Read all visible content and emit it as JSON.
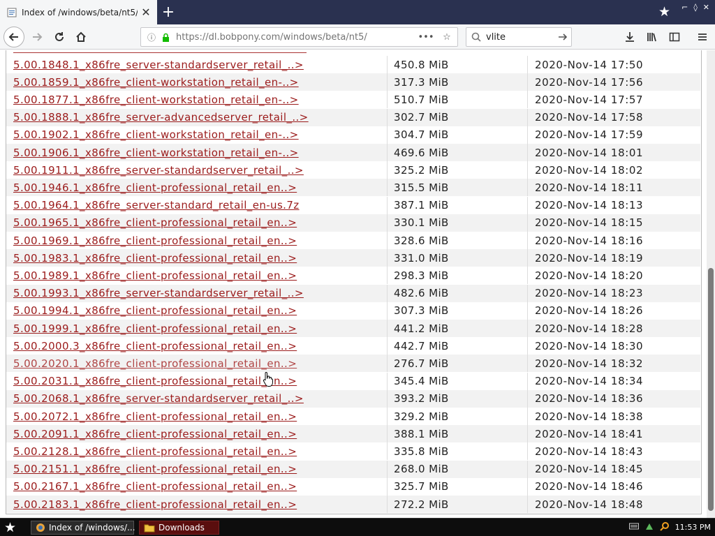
{
  "browser": {
    "tab": {
      "title": "Index of /windows/beta/nt5/",
      "close": "✕"
    },
    "new_tab": "+",
    "window_controls": [
      "⌐",
      "◊",
      "✕"
    ],
    "url": "https://dl.bobpony.com/windows/beta/nt5/",
    "search_value": "vlite"
  },
  "files": [
    {
      "name": "5.00.1848.1_x86fre_server-standardserver_retail_..>",
      "size": "450.8 MiB",
      "date": "2020-Nov-14 17:50"
    },
    {
      "name": "5.00.1859.1_x86fre_client-workstation_retail_en-..>",
      "size": "317.3 MiB",
      "date": "2020-Nov-14 17:56"
    },
    {
      "name": "5.00.1877.1_x86fre_client-workstation_retail_en-..>",
      "size": "510.7 MiB",
      "date": "2020-Nov-14 17:57"
    },
    {
      "name": "5.00.1888.1_x86fre_server-advancedserver_retail_..>",
      "size": "302.7 MiB",
      "date": "2020-Nov-14 17:58"
    },
    {
      "name": "5.00.1902.1_x86fre_client-workstation_retail_en-..>",
      "size": "304.7 MiB",
      "date": "2020-Nov-14 17:59"
    },
    {
      "name": "5.00.1906.1_x86fre_client-workstation_retail_en-..>",
      "size": "469.6 MiB",
      "date": "2020-Nov-14 18:01"
    },
    {
      "name": "5.00.1911.1_x86fre_server-standardserver_retail_..>",
      "size": "325.2 MiB",
      "date": "2020-Nov-14 18:02"
    },
    {
      "name": "5.00.1946.1_x86fre_client-professional_retail_en..>",
      "size": "315.5 MiB",
      "date": "2020-Nov-14 18:11"
    },
    {
      "name": "5.00.1964.1_x86fre_server-standard_retail_en-us.7z",
      "size": "387.1 MiB",
      "date": "2020-Nov-14 18:13"
    },
    {
      "name": "5.00.1965.1_x86fre_client-professional_retail_en..>",
      "size": "330.1 MiB",
      "date": "2020-Nov-14 18:15"
    },
    {
      "name": "5.00.1969.1_x86fre_client-professional_retail_en..>",
      "size": "328.6 MiB",
      "date": "2020-Nov-14 18:16"
    },
    {
      "name": "5.00.1983.1_x86fre_client-professional_retail_en..>",
      "size": "331.0 MiB",
      "date": "2020-Nov-14 18:19"
    },
    {
      "name": "5.00.1989.1_x86fre_client-professional_retail_en..>",
      "size": "298.3 MiB",
      "date": "2020-Nov-14 18:20"
    },
    {
      "name": "5.00.1993.1_x86fre_server-standardserver_retail_..>",
      "size": "482.6 MiB",
      "date": "2020-Nov-14 18:23"
    },
    {
      "name": "5.00.1994.1_x86fre_client-professional_retail_en..>",
      "size": "307.3 MiB",
      "date": "2020-Nov-14 18:26"
    },
    {
      "name": "5.00.1999.1_x86fre_client-professional_retail_en..>",
      "size": "441.2 MiB",
      "date": "2020-Nov-14 18:28"
    },
    {
      "name": "5.00.2000.3_x86fre_client-professional_retail_en..>",
      "size": "442.7 MiB",
      "date": "2020-Nov-14 18:30"
    },
    {
      "name": "5.00.2020.1_x86fre_client-professional_retail_en..>",
      "size": "276.7 MiB",
      "date": "2020-Nov-14 18:32"
    },
    {
      "name": "5.00.2031.1_x86fre_client-professional_retail_en..>",
      "size": "345.4 MiB",
      "date": "2020-Nov-14 18:34"
    },
    {
      "name": "5.00.2068.1_x86fre_server-standardserver_retail_..>",
      "size": "393.2 MiB",
      "date": "2020-Nov-14 18:36"
    },
    {
      "name": "5.00.2072.1_x86fre_client-professional_retail_en..>",
      "size": "329.2 MiB",
      "date": "2020-Nov-14 18:38"
    },
    {
      "name": "5.00.2091.1_x86fre_client-professional_retail_en..>",
      "size": "388.1 MiB",
      "date": "2020-Nov-14 18:41"
    },
    {
      "name": "5.00.2128.1_x86fre_client-professional_retail_en..>",
      "size": "335.8 MiB",
      "date": "2020-Nov-14 18:43"
    },
    {
      "name": "5.00.2151.1_x86fre_client-professional_retail_en..>",
      "size": "268.0 MiB",
      "date": "2020-Nov-14 18:45"
    },
    {
      "name": "5.00.2167.1_x86fre_client-professional_retail_en..>",
      "size": "325.7 MiB",
      "date": "2020-Nov-14 18:46"
    },
    {
      "name": "5.00.2183.1_x86fre_client-professional_retail_en..>",
      "size": "272.2 MiB",
      "date": "2020-Nov-14 18:48"
    }
  ],
  "taskbar": {
    "tasks": [
      {
        "label": "Index of /windows/..."
      },
      {
        "label": "Downloads"
      }
    ],
    "clock": "11:53 PM"
  },
  "colors": {
    "link": "#9b1b1b",
    "tabstrip": "#2a3150",
    "taskbar": "#0d0d0d",
    "downloads_task": "#5a0e0e"
  }
}
